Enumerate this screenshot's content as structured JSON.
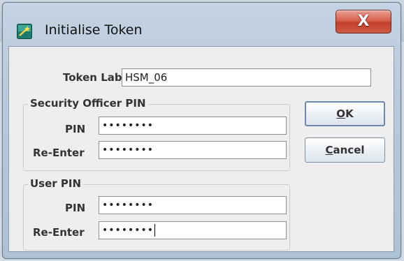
{
  "window": {
    "title": "Initialise Token",
    "close_label": "X"
  },
  "form": {
    "token_label": {
      "label": "Token Label",
      "value": "HSM_06"
    },
    "security_officer": {
      "group_title": "Security Officer PIN",
      "pin_label": "PIN",
      "pin_value": "••••••••",
      "reenter_label": "Re-Enter",
      "reenter_value": "••••••••"
    },
    "user": {
      "group_title": "User PIN",
      "pin_label": "PIN",
      "pin_value": "••••••••",
      "reenter_label": "Re-Enter",
      "reenter_value": "••••••••"
    }
  },
  "buttons": {
    "ok": {
      "mnemonic": "O",
      "rest": "K"
    },
    "cancel": {
      "mnemonic": "C",
      "rest": "ancel"
    }
  },
  "icons": {
    "app": "token-wand-icon",
    "close": "close-icon"
  }
}
